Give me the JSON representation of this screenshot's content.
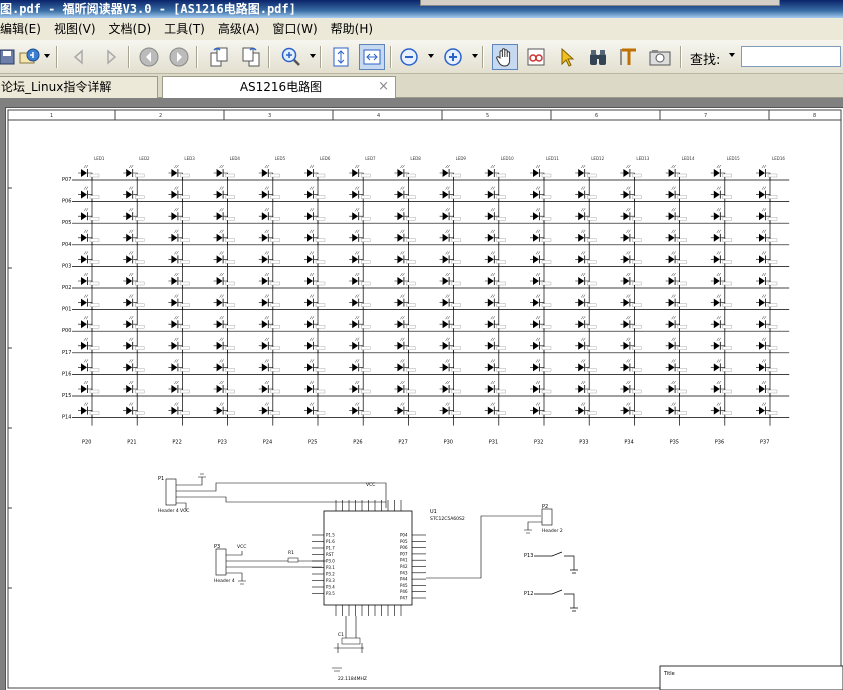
{
  "window": {
    "title": "图.pdf - 福昕阅读器V3.0 - [AS1216电路图.pdf]"
  },
  "menu": [
    "编辑(E)",
    "视图(V)",
    "文档(D)",
    "工具(T)",
    "高级(A)",
    "窗口(W)",
    "帮助(H)"
  ],
  "toolbar": {
    "icons": [
      "save-icon",
      "email-icon",
      "prev-page-icon",
      "next-page-icon",
      "back-icon",
      "forward-icon",
      "rotate-left-icon",
      "rotate-right-icon",
      "zoom-in-icon",
      "fit-page-icon",
      "fit-width-icon",
      "zoom-out-minus-icon",
      "zoom-in-plus-icon",
      "hand-tool-icon",
      "reader-glasses-icon",
      "select-arrow-icon",
      "find-binoculars-icon",
      "text-select-icon",
      "snapshot-camera-icon"
    ],
    "search_label": "查找:",
    "search_value": ""
  },
  "tabs": [
    {
      "label": "论坛_Linux指令详解",
      "active": false
    },
    {
      "label": "AS1216电路图",
      "active": true,
      "close": "×"
    }
  ],
  "schematic": {
    "col_numbers": [
      "1",
      "2",
      "3",
      "4",
      "5",
      "6",
      "7",
      "8"
    ],
    "row_ports": [
      "P07",
      "P06",
      "P05",
      "P04",
      "P03",
      "P02",
      "P01",
      "P00",
      "P17",
      "P16",
      "P15",
      "P14"
    ],
    "col_ports": [
      "P20",
      "P21",
      "P22",
      "P23",
      "P24",
      "P25",
      "P26",
      "P27",
      "P30",
      "P31",
      "P32",
      "P33",
      "P34",
      "P35",
      "P36",
      "P37"
    ],
    "chip_name": "U1",
    "chip_part": "STC12C5A60S2",
    "vcc_label": "VCC",
    "connectors": [
      "P1",
      "P2",
      "P3"
    ],
    "header_labels": [
      "Header 4",
      "Header 2",
      "Header 4"
    ],
    "resistor_label": "R1",
    "cap_label": "C1",
    "crystal_label": "22.1184MHZ",
    "pin_labels_left": [
      "P1.5",
      "P1.6",
      "P1.7",
      "RST",
      "P3.0",
      "P3.1",
      "P3.2",
      "P3.3",
      "P3.4",
      "P3.5"
    ],
    "pin_labels_right": [
      "P04",
      "P05",
      "P06",
      "P07",
      "P41",
      "P42",
      "P43",
      "P44",
      "P45",
      "P46",
      "P47"
    ],
    "switch_labels": [
      "P13",
      "P12"
    ],
    "title_block": "Title"
  }
}
